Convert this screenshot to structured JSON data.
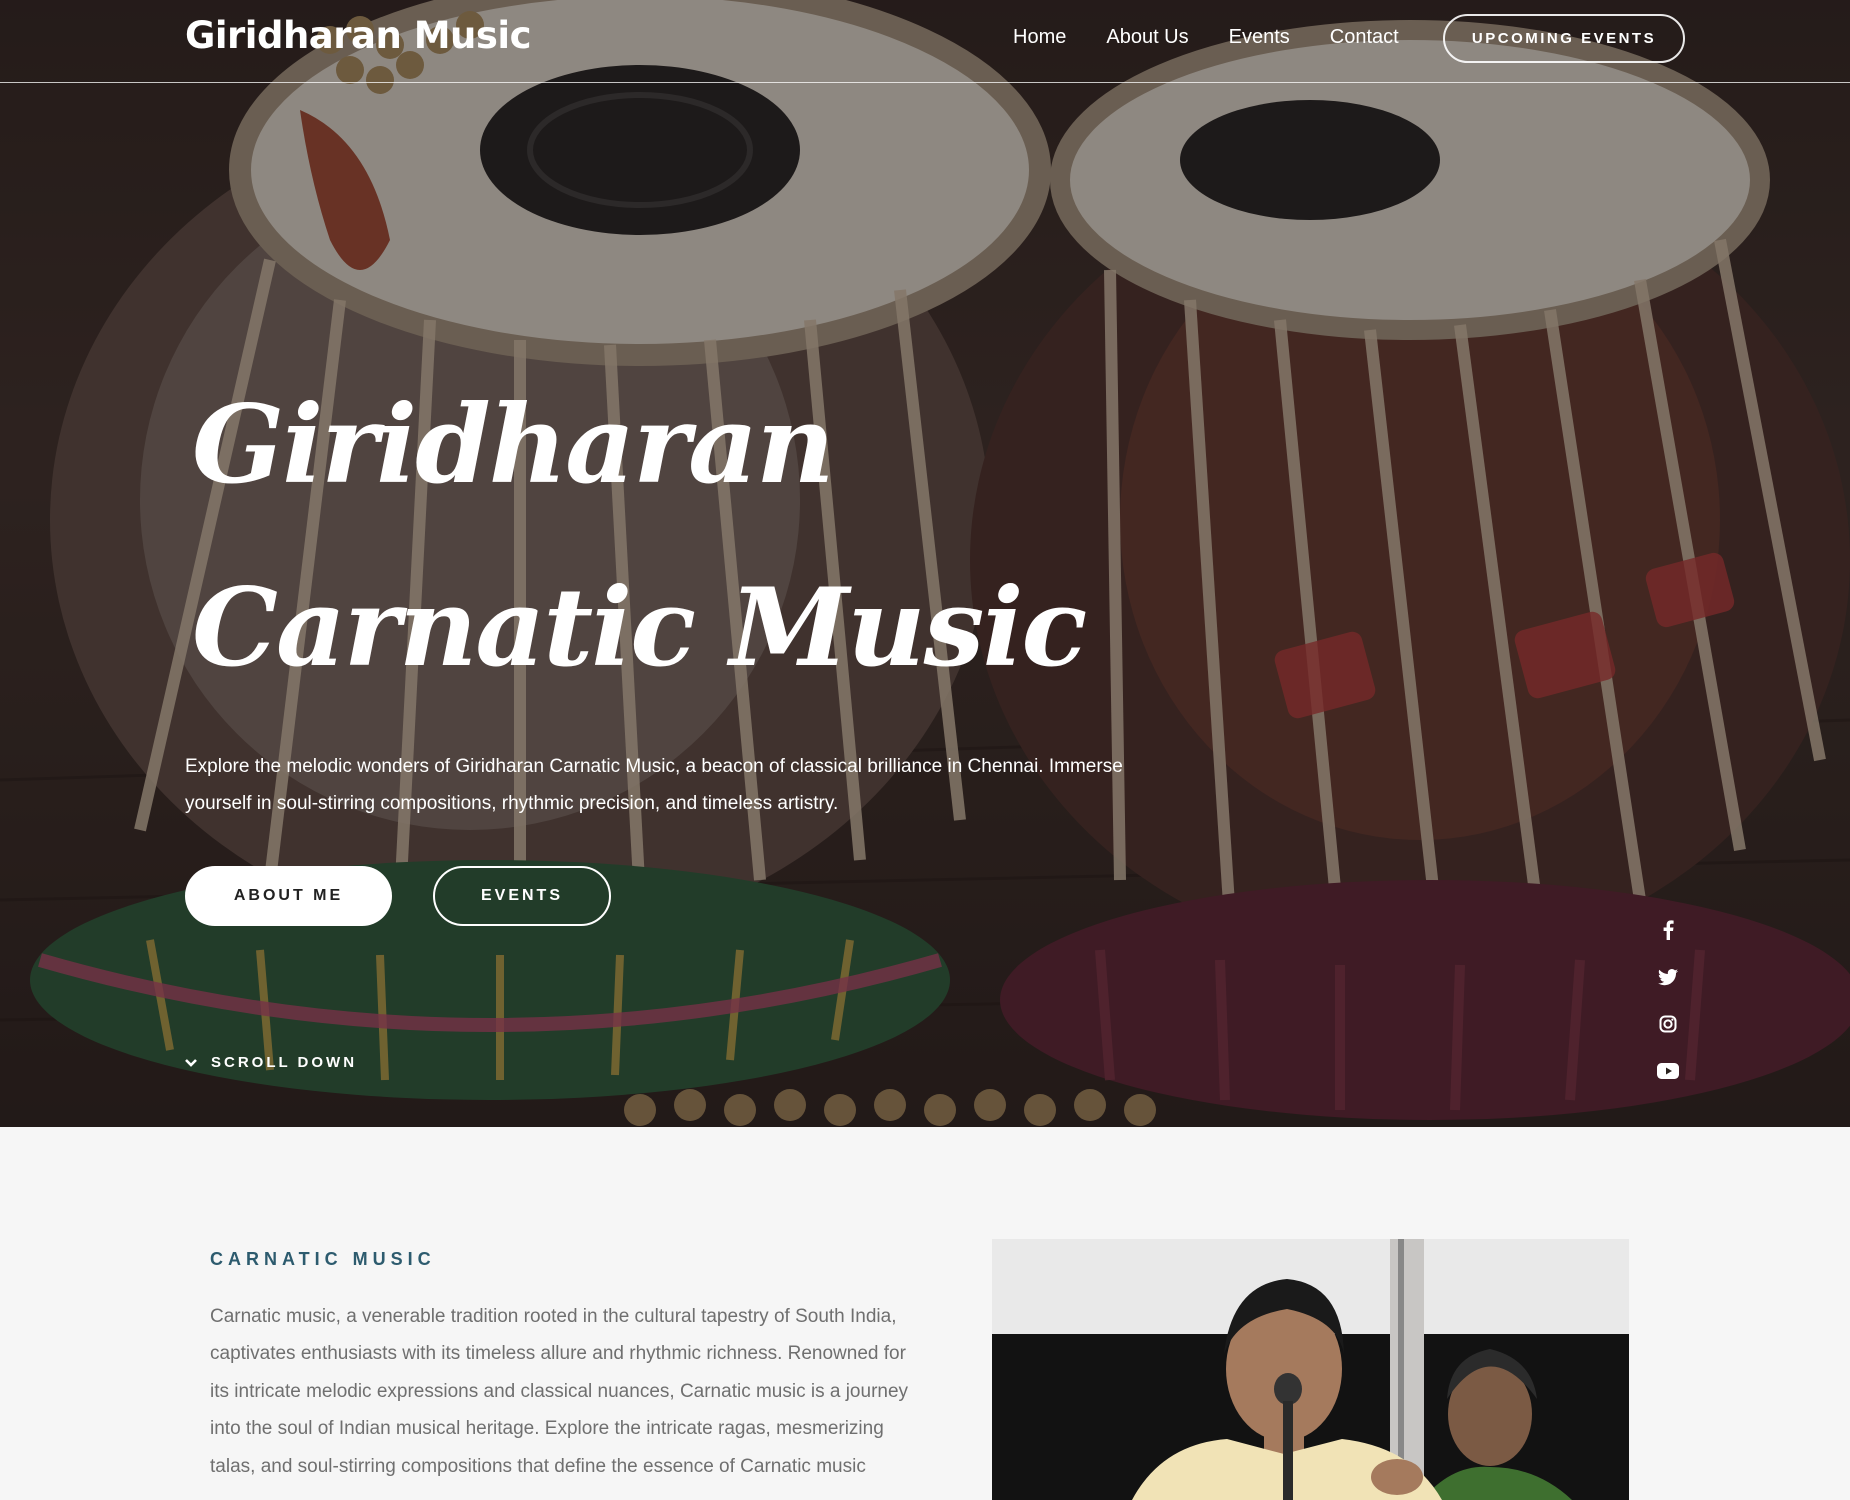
{
  "nav": {
    "brand": "Giridharan Music",
    "links": [
      "Home",
      "About Us",
      "Events",
      "Contact"
    ],
    "cta": "UPCOMING EVENTS"
  },
  "hero": {
    "title_line1": "Giridharan",
    "title_line2": "Carnatic Music",
    "intro": "Explore the melodic wonders of Giridharan Carnatic Music, a beacon of classical brilliance in Chennai. Immerse yourself in soul-stirring compositions, rhythmic precision, and timeless artistry.",
    "button_primary": "ABOUT ME",
    "button_secondary": "EVENTS",
    "scroll_label": "SCROLL DOWN",
    "social_icons": [
      "facebook-icon",
      "twitter-icon",
      "instagram-icon",
      "youtube-icon"
    ]
  },
  "about": {
    "eyebrow": "CARNATIC MUSIC",
    "text": "Carnatic music, a venerable tradition rooted in the cultural tapestry of South India, captivates enthusiasts with its timeless allure and rhythmic richness. Renowned for its intricate melodic expressions and classical nuances, Carnatic music is a journey into the soul of Indian musical heritage. Explore the intricate ragas, mesmerizing talas, and soul-stirring compositions that define the essence of Carnatic music"
  },
  "colors": {
    "accent": "#2d5b6e",
    "body_text": "#6f6f6f",
    "section_bg": "#f6f6f6"
  }
}
